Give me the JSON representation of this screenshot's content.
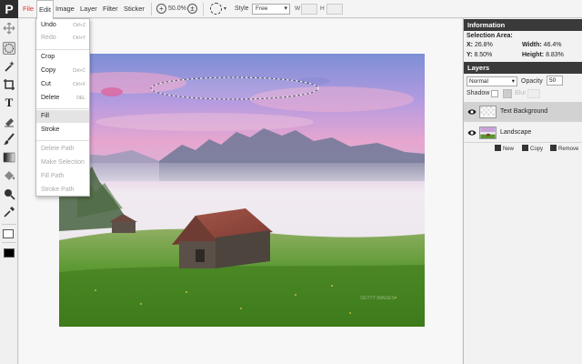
{
  "app": {
    "logo": "P"
  },
  "menubar": {
    "items": [
      {
        "label": "File"
      },
      {
        "label": "Edit"
      },
      {
        "label": "Image"
      },
      {
        "label": "Layer"
      },
      {
        "label": "Filter"
      },
      {
        "label": "Sticker"
      }
    ]
  },
  "options_bar": {
    "zoom_out_glyph": "+",
    "zoom": "50.0%",
    "zoom_in_glyph": "±",
    "selection_caret": "▾",
    "style_label": "Style",
    "style_value": "Free",
    "width_label": "W",
    "width_value": "",
    "height_label": "H",
    "height_value": ""
  },
  "tools": [
    {
      "name": "move-tool-icon"
    },
    {
      "name": "ellipse-select-tool-icon"
    },
    {
      "name": "magic-wand-tool-icon"
    },
    {
      "name": "crop-tool-icon"
    },
    {
      "name": "text-tool-icon",
      "glyph": "T"
    },
    {
      "name": "eraser-tool-icon"
    },
    {
      "name": "brush-tool-icon"
    },
    {
      "name": "gradient-tool-icon"
    },
    {
      "name": "paint-bucket-tool-icon"
    },
    {
      "name": "smudge-tool-icon"
    },
    {
      "name": "eyedropper-tool-icon"
    }
  ],
  "colors": {
    "background": "#ffffff",
    "foreground": "#000000",
    "accent": "#d33333",
    "panel_header": "#3a3a3a"
  },
  "edit_menu": {
    "items": [
      {
        "label": "Undo",
        "shortcut": "Ctrl+Z",
        "disabled": false
      },
      {
        "label": "Redo",
        "shortcut": "Ctrl+Y",
        "disabled": true
      },
      {
        "label": "Crop",
        "shortcut": "",
        "disabled": false
      },
      {
        "label": "Copy",
        "shortcut": "Ctrl+C",
        "disabled": false
      },
      {
        "label": "Cut",
        "shortcut": "Ctrl+X",
        "disabled": false
      },
      {
        "label": "Delete",
        "shortcut": "DEL",
        "disabled": false
      },
      {
        "label": "Fill",
        "shortcut": "",
        "disabled": false,
        "hover": true
      },
      {
        "label": "Stroke",
        "shortcut": "",
        "disabled": false
      },
      {
        "label": "Delete Path",
        "shortcut": "",
        "disabled": true
      },
      {
        "label": "Make Selection",
        "shortcut": "",
        "disabled": true
      },
      {
        "label": "Fill Path",
        "shortcut": "",
        "disabled": true
      },
      {
        "label": "Stroke Path",
        "shortcut": "",
        "disabled": true
      }
    ]
  },
  "information": {
    "title": "Information",
    "selection_area_label": "Selection Area:",
    "x_label": "X:",
    "x_value": "26.8%",
    "y_label": "Y:",
    "y_value": "8.50%",
    "width_label": "Width:",
    "width_value": "46.4%",
    "height_label": "Height:",
    "height_value": "8.83%"
  },
  "layers": {
    "title": "Layers",
    "blend_mode": "Normal",
    "opacity_label": "Opacity",
    "opacity_value": "50",
    "shadow_label": "Shadow",
    "blur_label": "Blur",
    "items": [
      {
        "name": "Text Background",
        "visible": true,
        "active": true
      },
      {
        "name": "Landscape",
        "visible": true,
        "active": false
      }
    ],
    "new_label": "New",
    "copy_label": "Copy",
    "remove_label": "Remove"
  },
  "canvas": {
    "watermark": "GETTY IMAGES"
  }
}
